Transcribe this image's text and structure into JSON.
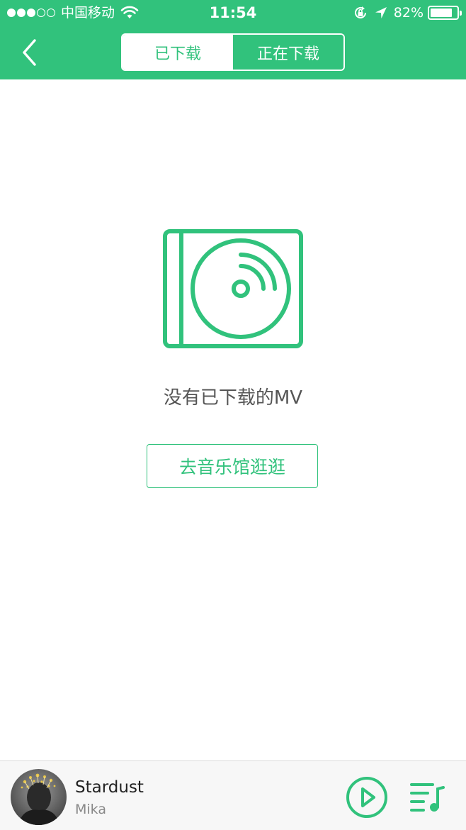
{
  "colors": {
    "accent": "#31c27c",
    "background": "#ffffff",
    "text_muted": "#555555"
  },
  "status_bar": {
    "signal": "●●●○○",
    "carrier": "中国移动",
    "time": "11:54",
    "battery_text": "82%",
    "battery_level": 0.82,
    "icons": [
      "wifi-icon",
      "rotation-lock-icon",
      "location-arrow-icon",
      "battery-icon"
    ]
  },
  "header": {
    "back_icon": "chevron-left-icon",
    "tabs": [
      {
        "label": "已下载",
        "active": true
      },
      {
        "label": "正在下载",
        "active": false
      }
    ]
  },
  "empty_state": {
    "icon": "cd-case-icon",
    "message": "没有已下载的MV",
    "button_label": "去音乐馆逛逛"
  },
  "player": {
    "title": "Stardust",
    "artist": "Mika",
    "play_icon": "play-circle-icon",
    "playlist_icon": "playlist-icon"
  }
}
